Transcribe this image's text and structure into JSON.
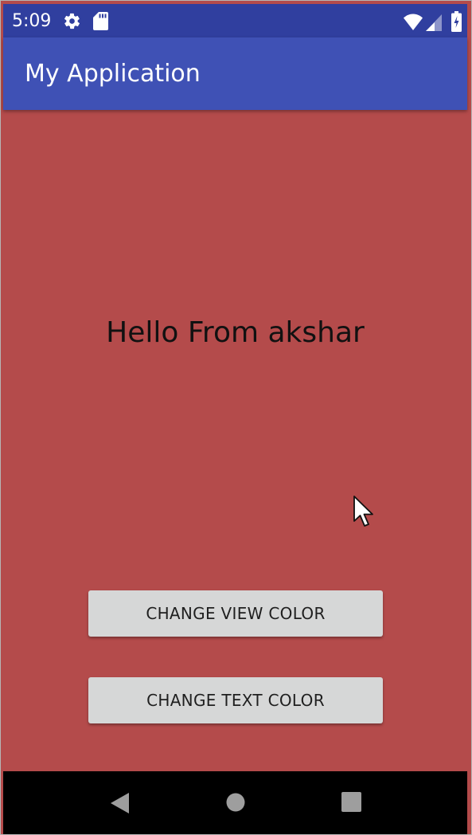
{
  "status_bar": {
    "time": "5:09",
    "icons": [
      "gear-icon",
      "sd-card-icon",
      "wifi-icon",
      "cell-signal-icon",
      "battery-charging-icon"
    ],
    "background": "#303f9f"
  },
  "app_bar": {
    "title": "My Application",
    "background": "#3f51b5"
  },
  "content": {
    "background": "#b44b4b",
    "hello_text": "Hello From akshar",
    "buttons": [
      {
        "label": "CHANGE VIEW COLOR"
      },
      {
        "label": "CHANGE TEXT COLOR"
      }
    ]
  },
  "nav_bar": {
    "buttons": [
      "back-icon",
      "home-icon",
      "recents-icon"
    ],
    "background": "#000000"
  }
}
